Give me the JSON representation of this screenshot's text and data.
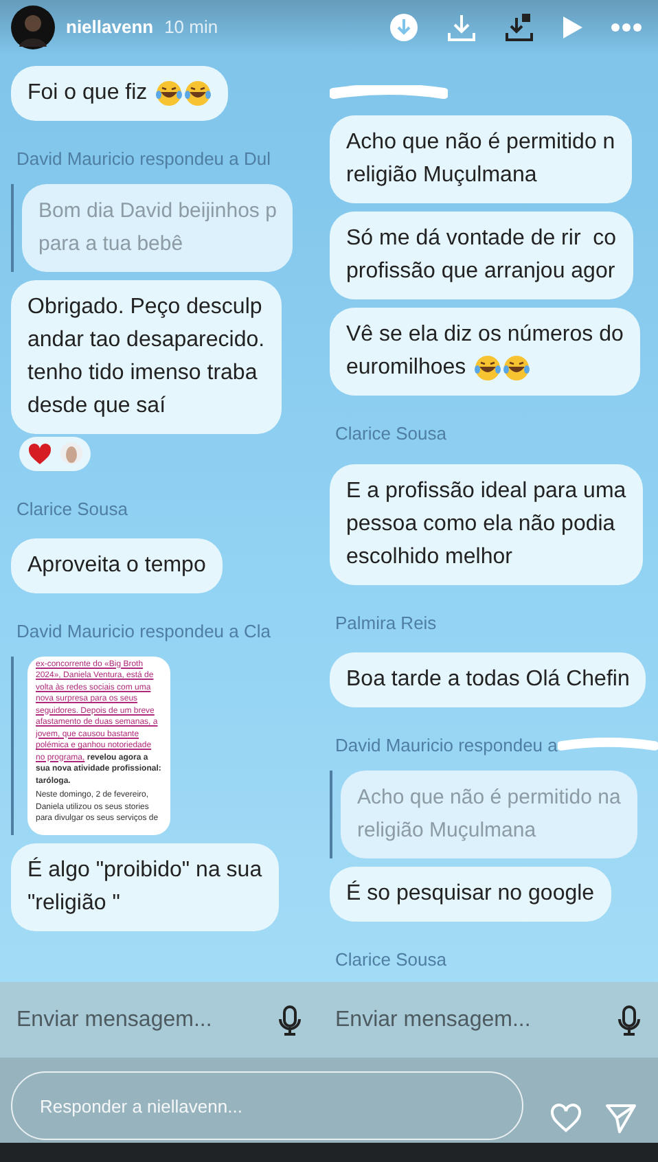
{
  "story": {
    "username": "niellavenn",
    "time": "10 min"
  },
  "left_chat": {
    "messages": [
      {
        "kind": "text",
        "text": "Foi o que fiz",
        "icons": [
          {
            "kind": "laugh"
          },
          {
            "kind": "laugh"
          }
        ]
      },
      {
        "kind": "name",
        "text": "David Mauricio respondeu a Dul"
      },
      {
        "kind": "quote",
        "text": "Bom dia David beijinhos p\npara a tua bebê"
      },
      {
        "kind": "text",
        "text": "Obrigado. Peço desculp\nandar tao desaparecido.\ntenho tido imenso traba\ndesde que saí"
      },
      {
        "kind": "reactions",
        "items": [
          {
            "kind": "heart"
          },
          {
            "kind": "avatar"
          }
        ]
      },
      {
        "kind": "name",
        "text": "Clarice Sousa"
      },
      {
        "kind": "text",
        "text": "Aproveita o tempo"
      },
      {
        "kind": "name",
        "text": "David Mauricio respondeu a Cla"
      },
      {
        "kind": "article",
        "link_text": "ex-concorrente do «Big Broth 2024», Daniela Ventura, está de volta às redes sociais com uma nova surpresa para os seus seguidores. Depois de um breve afastamento de duas semanas, a jovem, que causou bastante polémica e ganhou notoriedade no programa,",
        "bold_text": "revelou agora a sua nova atividade profissional: taróloga.",
        "text": "Neste domingo, 2 de fevereiro, Daniela utilizou os seus stories para divulgar os seus serviços de"
      },
      {
        "kind": "text",
        "text": "É algo \"proibido\" na sua\n\"religião \""
      }
    ],
    "input": {
      "placeholder": "Enviar mensagem..."
    }
  },
  "right_chat": {
    "messages": [
      {
        "kind": "redacted"
      },
      {
        "kind": "text",
        "text": "Acho que não é permitido n\nreligião Muçulmana"
      },
      {
        "kind": "text",
        "text": "Só me dá vontade de rir  co\nprofissão que arranjou agor"
      },
      {
        "kind": "text",
        "text": "Vê se ela diz os números do\neuromilhoes",
        "icons": [
          {
            "kind": "laugh"
          },
          {
            "kind": "laugh"
          }
        ]
      },
      {
        "kind": "name",
        "text": "Clarice Sousa"
      },
      {
        "kind": "text",
        "text": "E a profissão ideal para uma\npessoa como ela não podia\nescolhido melhor"
      },
      {
        "kind": "name",
        "text": "Palmira Reis"
      },
      {
        "kind": "text",
        "text": "Boa tarde a todas Olá Chefin"
      },
      {
        "kind": "name",
        "text": "David Mauricio respondeu a",
        "redacted": true
      },
      {
        "kind": "quote",
        "text": "Acho que não é permitido na\nreligião Muçulmana"
      },
      {
        "kind": "text",
        "text": "É so pesquisar no google"
      },
      {
        "kind": "name",
        "text": "Clarice Sousa"
      }
    ],
    "input": {
      "placeholder": "Enviar mensagem..."
    }
  },
  "reply": {
    "placeholder": "Responder a niellavenn..."
  }
}
